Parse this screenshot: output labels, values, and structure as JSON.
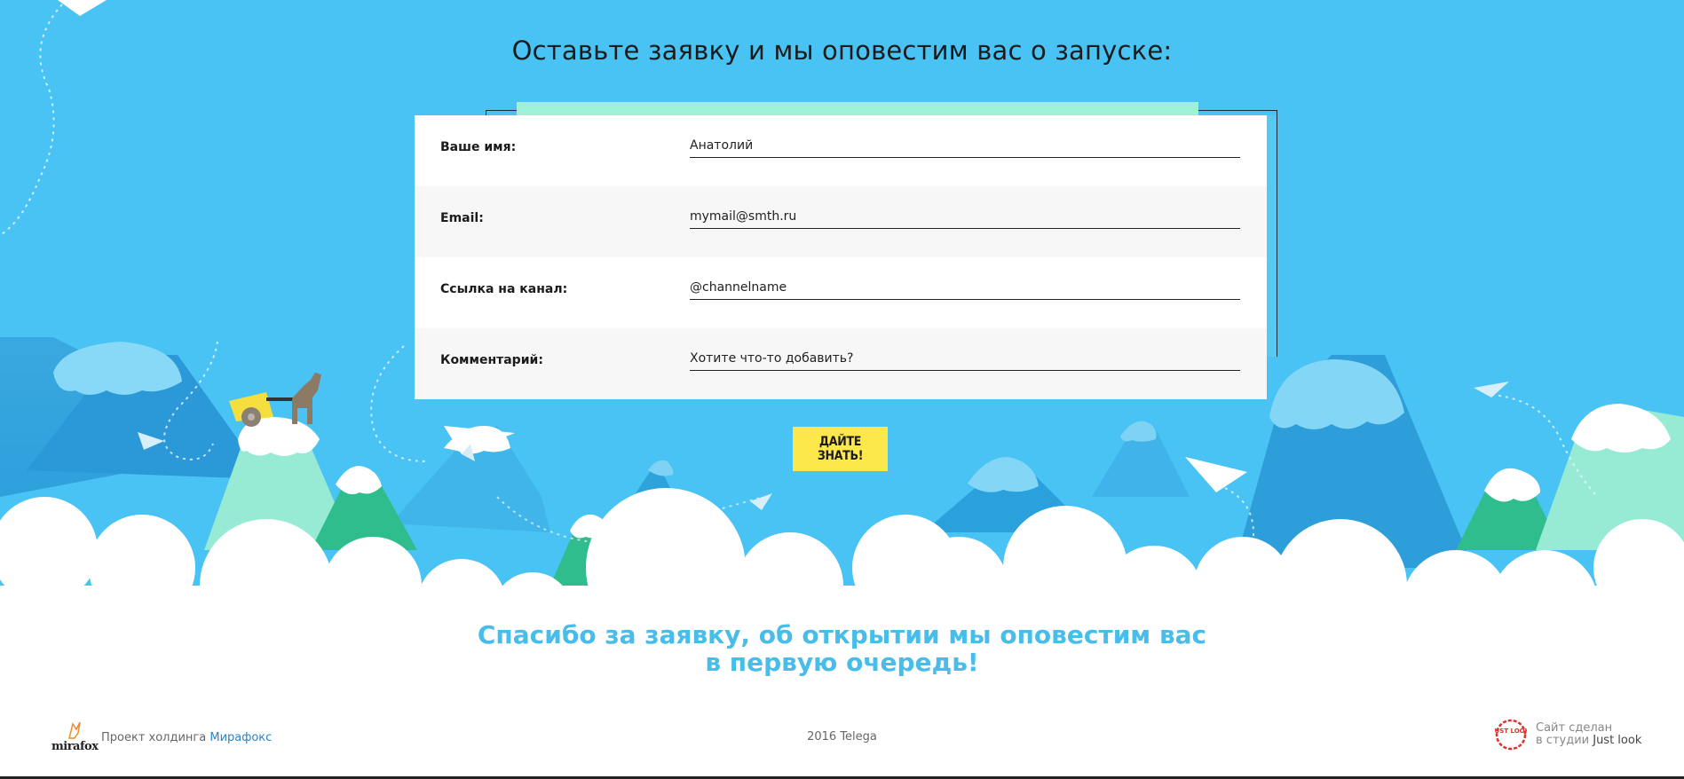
{
  "heading": "Оставьте заявку и мы оповестим вас о запуске:",
  "form": {
    "name_label": "Ваше имя:",
    "name_placeholder": "Анатолий",
    "email_label": "Email:",
    "email_placeholder": "mymail@smth.ru",
    "channel_label": "Ссылка на канал:",
    "channel_placeholder": "@channelname",
    "comment_label": "Комментарий:",
    "comment_placeholder": "Хотите что-то добавить?"
  },
  "submit_label": "ДАЙТЕ ЗНАТЬ!",
  "thanks": {
    "line1": "Спасибо за заявку, об открытии мы оповестим вас",
    "line2": "в первую очередь!"
  },
  "footer": {
    "logo_text": "mirafox",
    "project_text": "Проект холдинга ",
    "project_link": "Мирафокс",
    "copyright": "2016 Telega",
    "studio_line1": "Сайт сделан",
    "studio_line2_prefix": "в студии ",
    "studio_name": "Just look",
    "studio_badge_text": "JUST LOOK"
  },
  "colors": {
    "sky": "#48c3f3",
    "button": "#fde84c",
    "thanks_text": "#48bde9",
    "link": "#2a85c7"
  }
}
